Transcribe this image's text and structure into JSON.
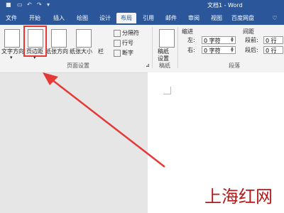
{
  "window": {
    "title": "文档1 - Word"
  },
  "quick_access": [
    {
      "icon": "word-logo-icon"
    },
    {
      "icon": "save-icon"
    },
    {
      "icon": "undo-icon"
    },
    {
      "icon": "redo-icon"
    },
    {
      "icon": "customize-icon"
    }
  ],
  "tabs": [
    {
      "label": "文件"
    },
    {
      "label": "开始"
    },
    {
      "label": "插入"
    },
    {
      "label": "绘图"
    },
    {
      "label": "设计"
    },
    {
      "label": "布局",
      "active": true
    },
    {
      "label": "引用"
    },
    {
      "label": "邮件"
    },
    {
      "label": "审阅"
    },
    {
      "label": "视图"
    },
    {
      "label": "百度网盘"
    }
  ],
  "ribbon": {
    "page_setup": {
      "text_direction": "文字方向",
      "margins": "页边距",
      "orientation": "纸张方向",
      "size": "纸张大小",
      "columns": "栏",
      "breaks": "分隔符",
      "line_numbers": "行号",
      "hyphenation": "断字",
      "group_label": "页面设置"
    },
    "draft": {
      "label1": "稿纸",
      "label2": "设置",
      "group_label": "稿纸"
    },
    "paragraph": {
      "indent_label": "缩进",
      "spacing_label": "间距",
      "left_label": "左:",
      "right_label": "右:",
      "before_label": "段前:",
      "after_label": "段后:",
      "left_value": "0 字符",
      "right_value": "0 字符",
      "before_value": "0 行",
      "after_value": "0 行",
      "group_label": "段落"
    }
  },
  "watermark": "上海红网",
  "colors": {
    "accent": "#2b579a",
    "highlight": "#e53935"
  }
}
